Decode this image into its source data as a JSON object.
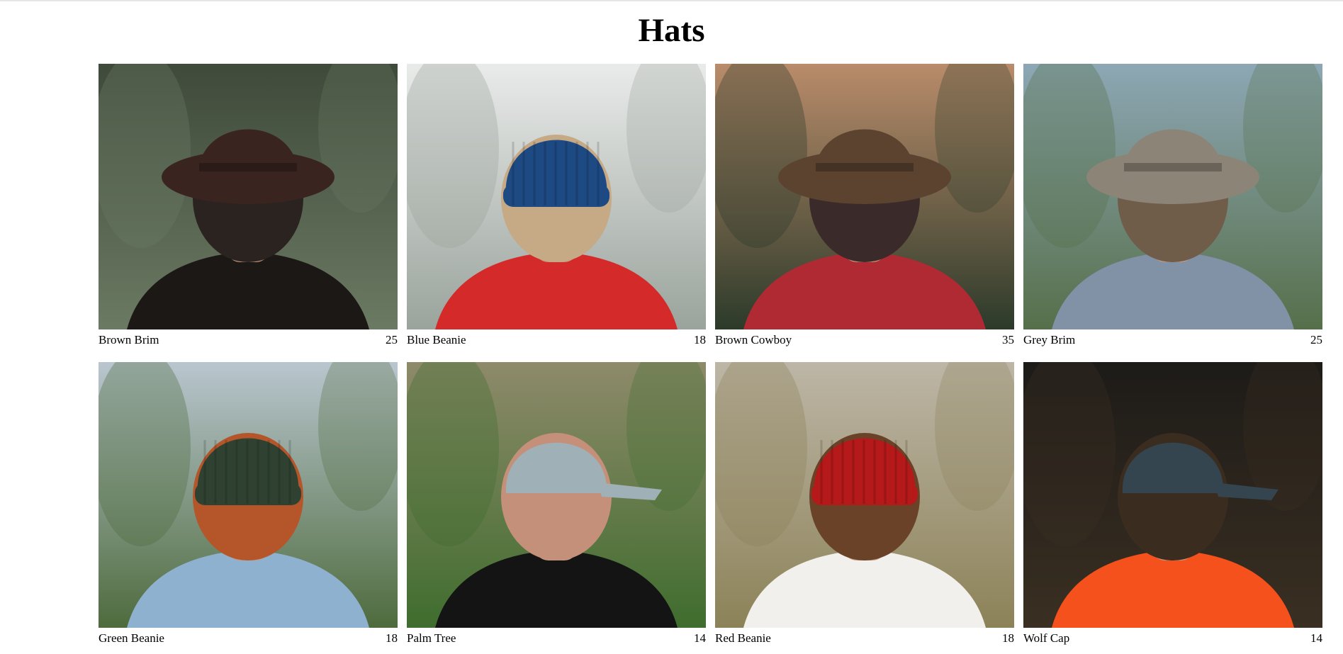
{
  "page": {
    "title": "Hats"
  },
  "products": [
    {
      "name": "Brown Brim",
      "price": "25",
      "icon": "brown-brim-photo",
      "bg": "#3f4a3a",
      "bg2": "#6b7a63",
      "hat": "#3a2420",
      "body": "#1c1816",
      "hair": "#2a2320"
    },
    {
      "name": "Blue Beanie",
      "price": "18",
      "icon": "blue-beanie-photo",
      "bg": "#e9ebea",
      "bg2": "#9aa39c",
      "hat": "#1e4a84",
      "body": "#d42a2a",
      "hair": "#c6a985"
    },
    {
      "name": "Brown Cowboy",
      "price": "35",
      "icon": "brown-cowboy-photo",
      "bg": "#b98c6a",
      "bg2": "#2c3a2a",
      "hat": "#5b4330",
      "body": "#b02a34",
      "hair": "#3a2a2a"
    },
    {
      "name": "Grey Brim",
      "price": "25",
      "icon": "grey-brim-photo",
      "bg": "#8da7b5",
      "bg2": "#566f4a",
      "hat": "#8d8478",
      "body": "#8191a6",
      "hair": "#6f5d4a"
    },
    {
      "name": "Green Beanie",
      "price": "18",
      "icon": "green-beanie-photo",
      "bg": "#b9c6cf",
      "bg2": "#4e6b3d",
      "hat": "#2f4232",
      "body": "#8eb1cf",
      "hair": "#b5552a"
    },
    {
      "name": "Palm Tree",
      "price": "14",
      "icon": "palm-tree-photo",
      "bg": "#8e8a6a",
      "bg2": "#3f6d2e",
      "hat": "#9fb0b7",
      "body": "#141414",
      "hair": "#c59079"
    },
    {
      "name": "Red Beanie",
      "price": "18",
      "icon": "red-beanie-photo",
      "bg": "#bdb6a6",
      "bg2": "#8c8258",
      "hat": "#b5191a",
      "body": "#f2f0ec",
      "hair": "#6a4228"
    },
    {
      "name": "Wolf Cap",
      "price": "14",
      "icon": "wolf-cap-photo",
      "bg": "#1d1b18",
      "bg2": "#3a2f22",
      "hat": "#344550",
      "body": "#f4511d",
      "hair": "#3b2c20"
    }
  ]
}
